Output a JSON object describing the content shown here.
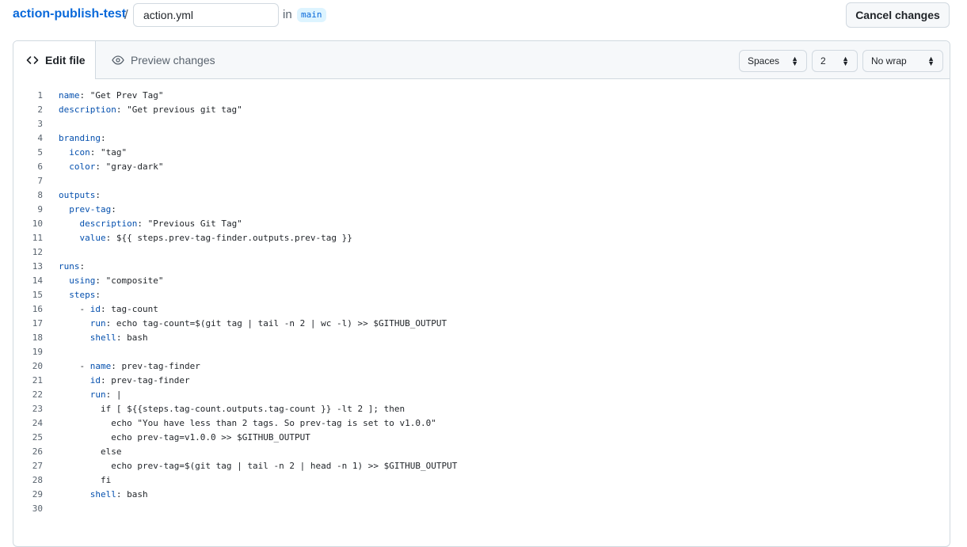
{
  "header": {
    "repo": "action-publish-test",
    "slash": "/",
    "filename": "action.yml",
    "in_text": "in",
    "branch": "main",
    "cancel_label": "Cancel changes"
  },
  "tabs": {
    "edit_label": "Edit file",
    "preview_label": "Preview changes"
  },
  "controls": {
    "indent_mode": "Spaces",
    "indent_size": "2",
    "wrap_mode": "No wrap"
  },
  "code_lines": [
    "name: \"Get Prev Tag\"",
    "description: \"Get previous git tag\"",
    "",
    "branding:",
    "  icon: \"tag\"",
    "  color: \"gray-dark\"",
    "",
    "outputs:",
    "  prev-tag:",
    "    description: \"Previous Git Tag\"",
    "    value: ${{ steps.prev-tag-finder.outputs.prev-tag }}",
    "",
    "runs:",
    "  using: \"composite\"",
    "  steps:",
    "    - id: tag-count",
    "      run: echo tag-count=$(git tag | tail -n 2 | wc -l) >> $GITHUB_OUTPUT",
    "      shell: bash",
    "",
    "    - name: prev-tag-finder",
    "      id: prev-tag-finder",
    "      run: |",
    "        if [ ${{steps.tag-count.outputs.tag-count }} -lt 2 ]; then",
    "          echo \"You have less than 2 tags. So prev-tag is set to v1.0.0\"",
    "          echo prev-tag=v1.0.0 >> $GITHUB_OUTPUT",
    "        else",
    "          echo prev-tag=$(git tag | tail -n 2 | head -n 1) >> $GITHUB_OUTPUT",
    "        fi",
    "      shell: bash",
    ""
  ]
}
